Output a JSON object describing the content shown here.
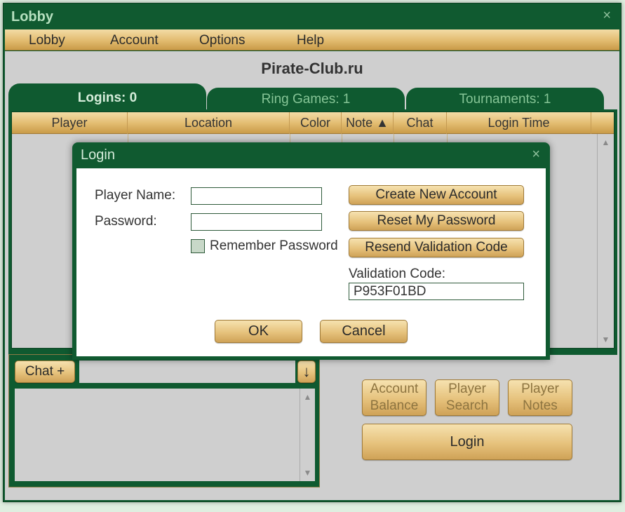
{
  "window": {
    "title": "Lobby",
    "close_glyph": "×"
  },
  "menu": {
    "items": [
      {
        "label": "Lobby"
      },
      {
        "label": "Account"
      },
      {
        "label": "Options"
      },
      {
        "label": "Help"
      }
    ]
  },
  "site_title": "Pirate-Club.ru",
  "tabs": [
    {
      "label": "Logins: 0",
      "active": true
    },
    {
      "label": "Ring Games: 1",
      "active": false
    },
    {
      "label": "Tournaments: 1",
      "active": false
    }
  ],
  "table": {
    "columns": [
      "Player",
      "Location",
      "Color",
      "Note ▲",
      "Chat",
      "Login Time"
    ]
  },
  "scroll": {
    "up_glyph": "▲",
    "down_glyph": "▼"
  },
  "chat": {
    "button_label": "Chat +",
    "down_glyph": "↓",
    "input_value": ""
  },
  "actions": {
    "account_balance": "Account Balance",
    "player_search": "Player Search",
    "player_notes": "Player Notes",
    "login": "Login"
  },
  "login_dialog": {
    "title": "Login",
    "close_glyph": "×",
    "player_name_label": "Player Name:",
    "player_name_value": "",
    "password_label": "Password:",
    "password_value": "",
    "remember_label": "Remember Password",
    "create_account": "Create New Account",
    "reset_password": "Reset My Password",
    "resend_code": "Resend Validation Code",
    "validation_label": "Validation Code:",
    "validation_value": "P953F01BD",
    "ok": "OK",
    "cancel": "Cancel"
  },
  "colors": {
    "window_green": "#105a30",
    "gold": "#e2bb6f",
    "panel_gray": "#cfcfcf"
  }
}
